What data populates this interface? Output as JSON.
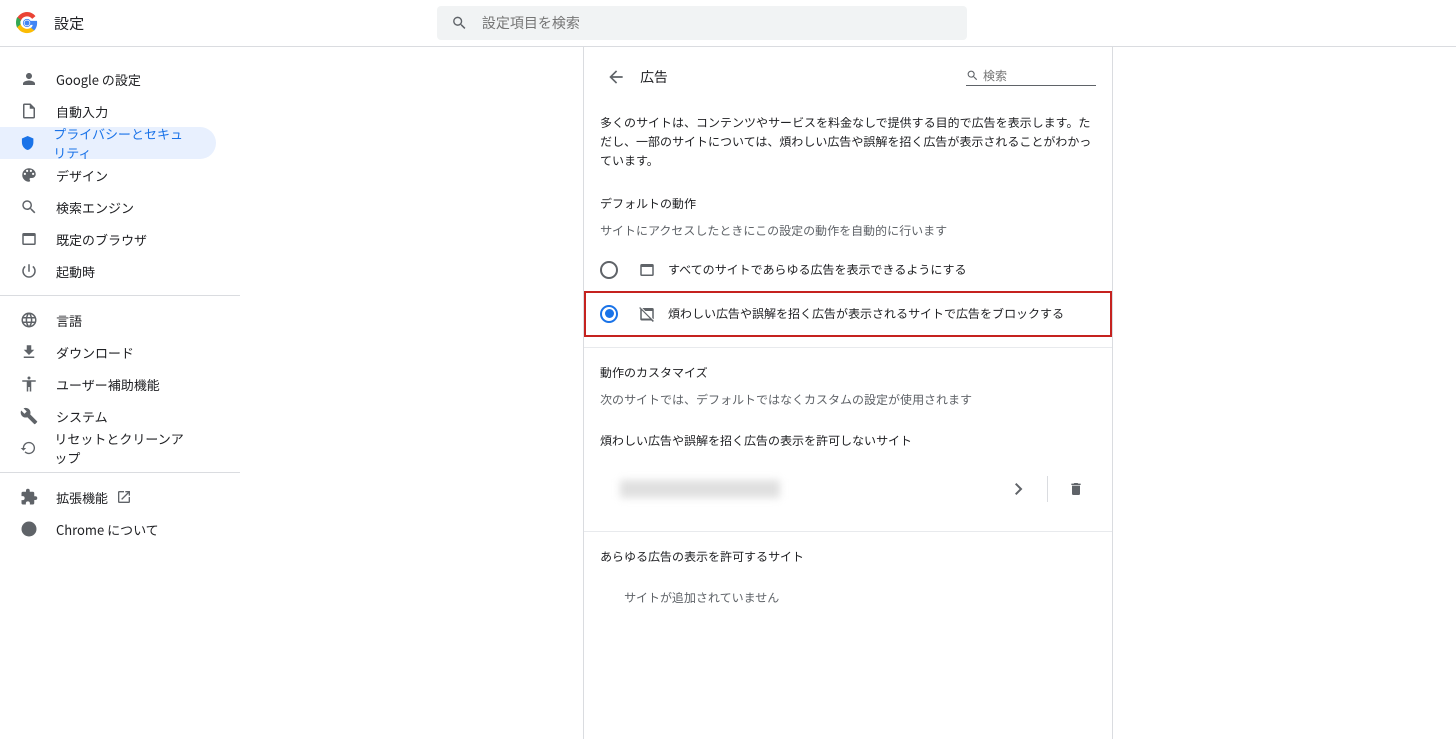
{
  "header": {
    "title": "設定"
  },
  "search": {
    "placeholder": "設定項目を検索"
  },
  "sidebar": {
    "group1": [
      {
        "label": "Google の設定"
      },
      {
        "label": "自動入力"
      },
      {
        "label": "プライバシーとセキュリティ"
      },
      {
        "label": "デザイン"
      },
      {
        "label": "検索エンジン"
      },
      {
        "label": "既定のブラウザ"
      },
      {
        "label": "起動時"
      }
    ],
    "group2": [
      {
        "label": "言語"
      },
      {
        "label": "ダウンロード"
      },
      {
        "label": "ユーザー補助機能"
      },
      {
        "label": "システム"
      },
      {
        "label": "リセットとクリーンアップ"
      }
    ],
    "group3": [
      {
        "label": "拡張機能"
      },
      {
        "label": "Chrome について"
      }
    ]
  },
  "panel": {
    "title": "広告",
    "search_placeholder": "検索",
    "description": "多くのサイトは、コンテンツやサービスを料金なしで提供する目的で広告を表示します。ただし、一部のサイトについては、煩わしい広告や誤解を招く広告が表示されることがわかっています。",
    "default_heading": "デフォルトの動作",
    "default_sub": "サイトにアクセスしたときにこの設定の動作を自動的に行います",
    "option_allow": "すべてのサイトであらゆる広告を表示できるようにする",
    "option_block": "煩わしい広告や誤解を招く広告が表示されるサイトで広告をブロックする",
    "custom_heading": "動作のカスタマイズ",
    "custom_sub": "次のサイトでは、デフォルトではなくカスタムの設定が使用されます",
    "block_list_heading": "煩わしい広告や誤解を招く広告の表示を許可しないサイト",
    "allow_list_heading": "あらゆる広告の表示を許可するサイト",
    "empty_message": "サイトが追加されていません"
  }
}
